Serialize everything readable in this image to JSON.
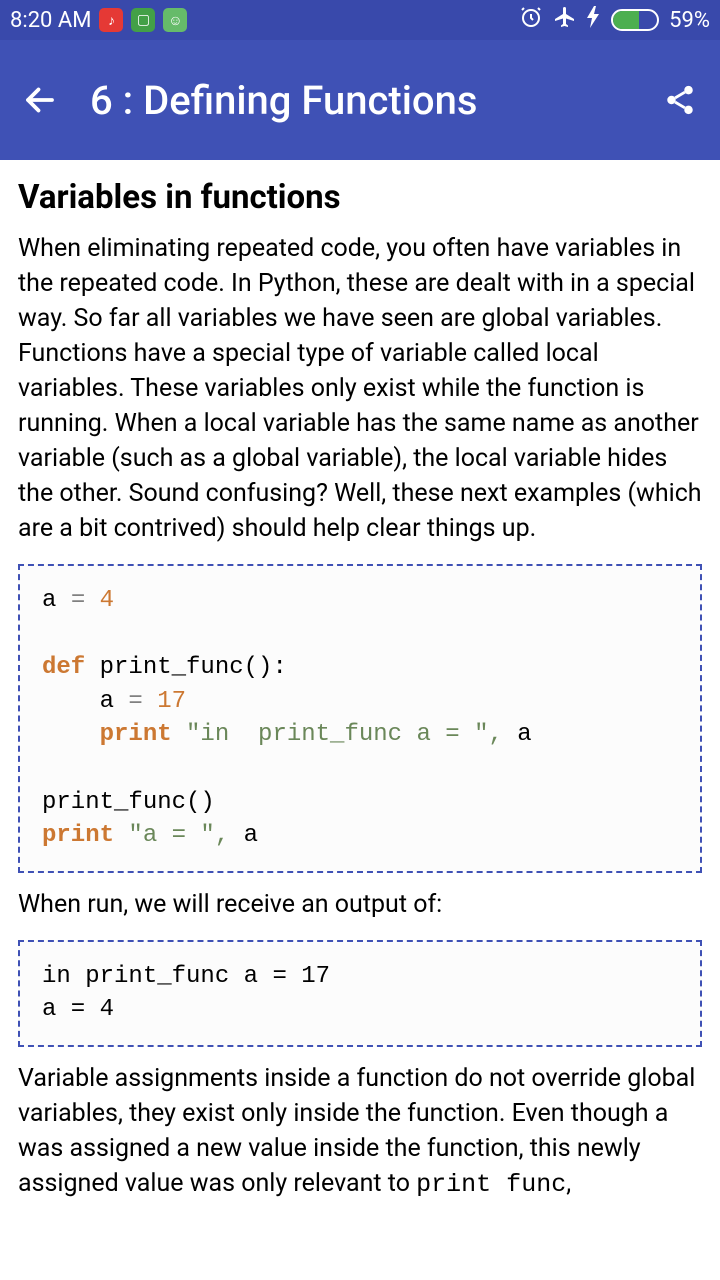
{
  "status": {
    "time": "8:20 AM",
    "battery_percent": "59%",
    "icons": {
      "music": "♪",
      "box": "▢",
      "face": "☺"
    }
  },
  "appbar": {
    "title": "6 : Defining Functions"
  },
  "content": {
    "heading": "Variables in functions",
    "para1": "When eliminating repeated code, you often have variables in the repeated code. In Python, these are dealt with in a special way. So far all variables we have seen are global variables. Functions have a special type of variable called local variables. These variables only exist while the function is running. When a local variable has the same name as another variable (such as a global variable), the local variable hides the other. Sound confusing? Well, these next examples (which are a bit contrived) should help clear things up.",
    "code1": {
      "l1_var": "a ",
      "l1_eq": "= ",
      "l1_num": "4",
      "l3_def": "def ",
      "l3_rest": "print_func():",
      "l4_pre": "    a ",
      "l4_eq": "= ",
      "l4_num": "17",
      "l5_pre": "    ",
      "l5_print": "print ",
      "l5_str": "\"in  print_func a = \"",
      "l5_comma": ", ",
      "l5_rest": "a",
      "l7": "print_func()",
      "l8_print": "print ",
      "l8_str": "\"a = \"",
      "l8_comma": ", ",
      "l8_rest": "a"
    },
    "para2": "When run, we will receive an output of:",
    "code2": "in print_func a = 17\na = 4\n",
    "para3_a": "Variable assignments inside a function do not override global variables, they exist only inside the function. Even though a was assigned a new value inside the function, this newly assigned value was only relevant to ",
    "para3_mono": "print func",
    "para3_b": ","
  }
}
